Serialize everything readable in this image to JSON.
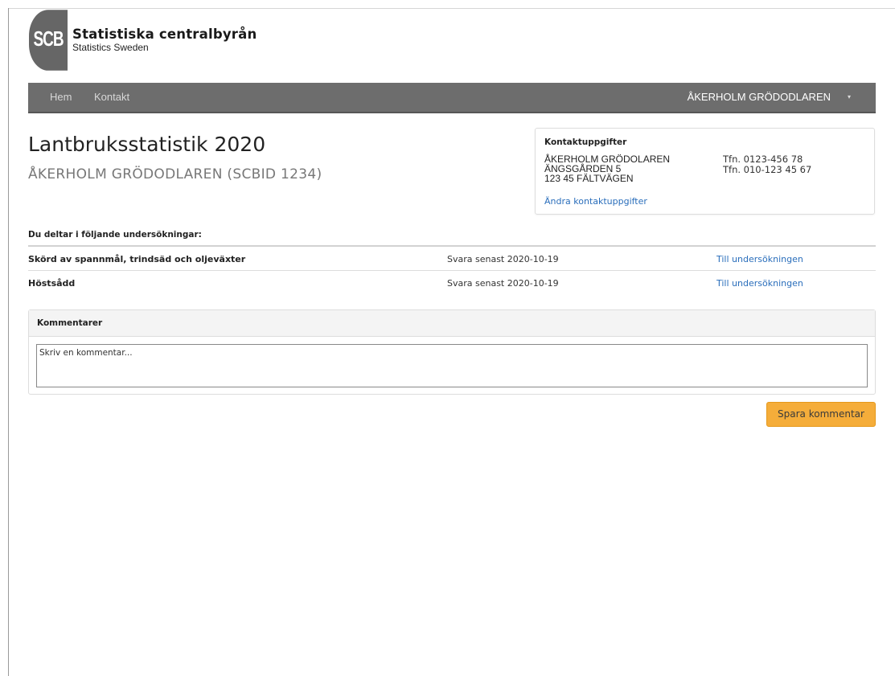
{
  "logo": {
    "mark": "SCB",
    "title": "Statistiska centralbyrån",
    "subtitle": "Statistics Sweden"
  },
  "nav": {
    "home": "Hem",
    "contact": "Kontakt",
    "user": "ÅKERHOLM GRÖDODLAREN",
    "caret": "▾"
  },
  "page": {
    "title": "Lantbruksstatistik 2020",
    "subtitle": "ÅKERHOLM GRÖDODLAREN (SCBID 1234)"
  },
  "contact": {
    "heading": "Kontaktuppgifter",
    "name": "ÅKERHOLM GRÖDOLAREN",
    "address1": "ÄNGSGÅRDEN 5",
    "address2": "123 45 FÄLTVÄGEN",
    "phone1": "Tfn. 0123-456 78",
    "phone2": "Tfn. 010-123 45 67",
    "edit_link": "Ändra kontaktuppgifter"
  },
  "surveys": {
    "heading": "Du deltar i följande undersökningar:",
    "rows": [
      {
        "name": "Skörd av spannmål, trindsäd och oljeväxter",
        "deadline": "Svara senast 2020-10-19",
        "link": "Till undersökningen"
      },
      {
        "name": "Höstsådd",
        "deadline": "Svara senast 2020-10-19",
        "link": "Till undersökningen"
      }
    ]
  },
  "comments": {
    "heading": "Kommentarer",
    "placeholder": "Skriv en kommentar...",
    "save_label": "Spara kommentar"
  },
  "colors": {
    "navbar": "#6d6d6d",
    "link": "#2a6ebb",
    "save_button": "#f5ad3a"
  }
}
